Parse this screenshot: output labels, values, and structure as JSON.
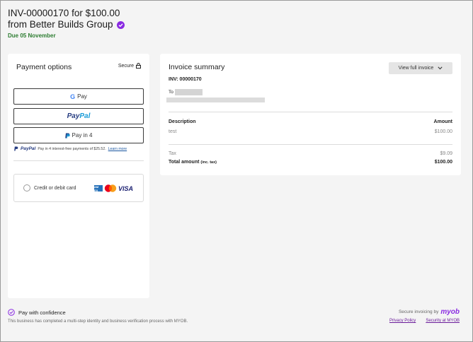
{
  "header": {
    "title_line1": "INV-00000170 for $100.00",
    "title_line2": "from Better Builds Group",
    "due": "Due 05 November"
  },
  "payment": {
    "title": "Payment options",
    "secure_label": "Secure",
    "gpay_label": "Pay",
    "gpay_letter": "G",
    "paypal_part1": "Pay",
    "paypal_part2": "Pal",
    "payin4_label": "Pay in 4",
    "pp_note_brand": "PayPal",
    "pp_note_text": "Pay in 4 interest-free payments of $25.52.",
    "pp_note_link": "Learn more",
    "card_option_label": "Credit or debit card",
    "amex_label": "AM EX",
    "visa_label": "VISA"
  },
  "invoice": {
    "title": "Invoice summary",
    "view_button": "View full invoice",
    "number": "INV: 00000170",
    "to_label": "To",
    "desc_header": "Description",
    "amount_header": "Amount",
    "line_item": {
      "desc": "test",
      "amount": "$100.00"
    },
    "tax": {
      "label": "Tax",
      "amount": "$9.09"
    },
    "total": {
      "label": "Total amount",
      "note": "(inc. tax)",
      "amount": "$100.00"
    }
  },
  "footer": {
    "confidence_title": "Pay with confidence",
    "confidence_desc": "This business has completed a multi-step identity and business verification process with MYOB.",
    "secure_invoicing": "Secure invoicing by",
    "brand": "myob",
    "privacy_link": "Privacy Policy",
    "security_link": "Security at MYOB"
  },
  "colors": {
    "accent_purple": "#8a2be2",
    "due_green": "#2e7d32",
    "paypal_dark": "#253b80",
    "paypal_light": "#179bd7"
  }
}
